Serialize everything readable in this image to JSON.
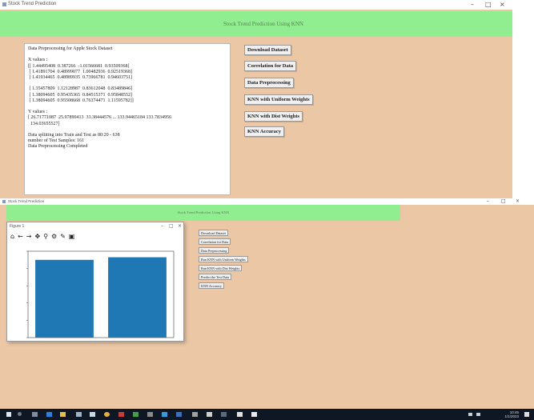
{
  "top_window": {
    "title": "Stock Trend Prediction",
    "banner": "Stock Trend Prediction Using KNN",
    "output_text": "Data Preprocessing for Apple Stock Dataset\n\nX values :\n[[ 1.44495408  0.387266  -1.01566681  0.93509368]\n [ 1.41891704  0.48999077  1.00482936  0.92519368]\n [ 1.41934465  0.48989935  0.73966781  0.94603751]\n\n [ 1.35457809  1.12128987  0.83612048  0.83489846]\n [ 1.38094605  0.95435365  0.84515371  0.95848552]\n [ 1.38094605  0.95508668  0.76374471  1.11595782]]\n\nY values :\n[ 26.71771087  25.97890413  33.38444576 ... 133.94465184 133.7834956\n  134.03655527]\n\nData splitting into Train and Test as 80:20 - 638\nnumber of Test Samples: 161\nData Preprocessing Completed",
    "buttons": [
      "Download Dataset",
      "Correlation for Data",
      "Data Preprocessing",
      "KNN with Uniform Weights",
      "KNN with Dist Weights",
      "KNN Accuracy"
    ]
  },
  "bottom_window": {
    "title": "Stock Trend Prediction",
    "banner": "Stock Trend Prediction Using KNN",
    "buttons": [
      "Download Dataset",
      "Correlation for Data",
      "Data Preprocessing",
      "Run KNN with Uniform Weights",
      "Run KNN with Dist Weights",
      "Predict the Test Data",
      "KNN Accuracy"
    ],
    "figure": {
      "title": "Figure 1",
      "toolbar_icons": [
        "home-icon",
        "back-icon",
        "forward-icon",
        "pan-icon",
        "zoom-icon",
        "configure-icon",
        "edit-icon",
        "save-icon"
      ]
    }
  },
  "chart_data": {
    "type": "bar",
    "categories": [
      "",
      ""
    ],
    "values": [
      0.9,
      0.93
    ],
    "ylim": [
      0,
      1.0
    ],
    "color": "#1f77b4"
  },
  "window_controls": [
    "minimize-icon",
    "maximize-icon",
    "close-icon"
  ],
  "taskbar": {
    "clock_time": "10:45",
    "clock_date": "1/1/2023"
  }
}
